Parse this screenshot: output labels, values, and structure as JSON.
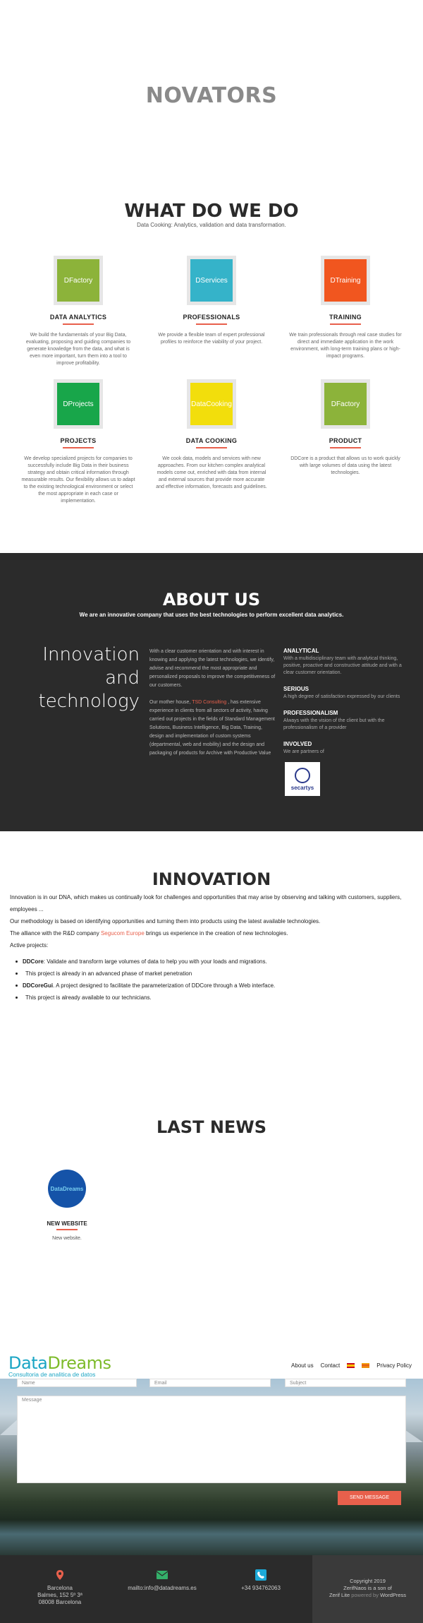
{
  "hero": {
    "title": "NOVATORS"
  },
  "services": {
    "title": "WHAT DO WE DO",
    "subtitle": "Data Cooking: Analytics, validation and data transformation.",
    "cards": [
      {
        "thumb": "DFactory",
        "color": "#8cb33a",
        "title": "DATA ANALYTICS",
        "desc": "We build the fundamentals of your Big Data, evaluating, proposing and guiding companies to generate knowledge from the data, and what is even more important, turn them into a tool to improve profitability."
      },
      {
        "thumb": "DServices",
        "color": "#35b3c9",
        "title": "PROFESSIONALS",
        "desc": "We provide a flexible team of expert professional profiles to reinforce the viability of your project."
      },
      {
        "thumb": "DTraining",
        "color": "#f1561f",
        "title": "TRAINING",
        "desc": "We train professionals through real case studies for direct and immediate application in the work environment, with long-term training plans or high-impact programs."
      },
      {
        "thumb": "DProjects",
        "color": "#18a64a",
        "title": "PROJECTS",
        "desc": "We develop specialized projects for companies to successfully include Big Data in their business strategy and obtain critical information through measurable results. Our flexibility allows us to adapt to the existing technological environment or select the most appropriate in each case or implementation."
      },
      {
        "thumb": "DataCooking",
        "color": "#f2de0c",
        "title": "DATA COOKING",
        "desc": "We cook data, models and services with new approaches. From our kitchen complex analytical models come out, enriched with data from internal and external sources that provide more accurate and effective information, forecasts and guidelines."
      },
      {
        "thumb": "DFactory",
        "color": "#8cb33a",
        "title": "PRODUCT",
        "desc": "DDCore is a product that allows us to work quickly with large volumes of data using the latest technologies."
      }
    ]
  },
  "about": {
    "title": "ABOUT US",
    "subtitle": "We are an innovative company that uses the best technologies to perform excellent data analytics.",
    "big_1": "Innovation",
    "big_2": "and",
    "big_3": "technology",
    "p1": "With a clear customer orientation and with interest in knowing and applying the latest technologies, we identify, advise and recommend the most appropriate and personalized proposals to improve the competitiveness of our customers.",
    "p2_a": "Our mother house, ",
    "p2_link": "TSD Consulting",
    "p2_b": " , has extensive experience in clients from all sectors of activity, having carried out projects in the fields of Standard Management Solutions, Business Intelligence, Big Data, Training, design and implementation of custom systems (departmental, web and mobility) and the design and packaging of products for Archive with Productive Value",
    "features": [
      {
        "title": "ANALYTICAL",
        "desc": "With a multidisciplinary team with analytical thinking, positive, proactive and constructive attitude and with a clear customer orientation."
      },
      {
        "title": "SERIOUS",
        "desc": "A high degree of satisfaction expressed by our clients"
      },
      {
        "title": "PROFESSIONALISM",
        "desc": "Always with the vision of the client but with the professionalism of a provider"
      },
      {
        "title": "INVOLVED",
        "desc": "We are partners of"
      }
    ],
    "partner_logo": "secartys"
  },
  "innovation": {
    "title": "INNOVATION",
    "p1": "Innovation is in our DNA, which makes us continually look for challenges and opportunities that may arise by observing and talking with customers, suppliers, employees ...",
    "p2": "Our methodology is based on identifying opportunities and turning them into products using the latest available technologies.",
    "p3_a": "The alliance with the R&D company ",
    "p3_link": "Segucom Europe",
    "p3_b": " brings us experience in the creation of new technologies.",
    "p4": "Active projects:",
    "items": [
      {
        "name": "DDCore",
        "desc": ": Validate and transform large volumes of data to help you with your loads and migrations.",
        "note": "This project is already in an advanced phase of market penetration"
      },
      {
        "name": "DDCoreGui",
        "desc": ". A project designed to facilitate the parameterization of DDCore through a Web interface.",
        "note": "This project is already available to our technicians."
      }
    ]
  },
  "news": {
    "title": "LAST NEWS",
    "item_logo": "DataDreams",
    "item_title": "NEW WEBSITE",
    "item_desc": "New website."
  },
  "header": {
    "brand_1": "Data",
    "brand_2": "Dreams",
    "tagline": "Consultoria de analitica de datos",
    "nav": [
      "About us",
      "Contact",
      "Privacy Policy"
    ]
  },
  "form": {
    "name_placeholder": "Name",
    "email_placeholder": "Email",
    "subject_placeholder": "Subject",
    "message_placeholder": "Message",
    "send_label": "SEND MESSAGE"
  },
  "footer": {
    "address_1": "Barcelona",
    "address_2": "Balmes, 152 5º 3ª",
    "address_3": "08008 Barcelona",
    "email": "mailto:info@datadreams.es",
    "phone": "+34 934762063",
    "copy_1": "Copyright 2019",
    "copy_2": "ZerifNaos is a son of",
    "copy_3a": "Zerif Lite",
    "copy_3b": " powered by ",
    "copy_3c": "WordPress",
    "accent": "#e8604c"
  }
}
